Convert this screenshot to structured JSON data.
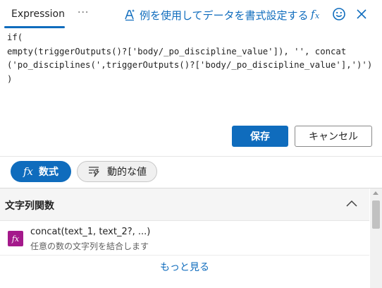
{
  "header": {
    "tab_label": "Expression",
    "more_label": "···",
    "format_label": "例を使用してデータを書式設定する"
  },
  "editor": {
    "line1": "if(",
    "line2": "empty(triggerOutputs()?['body/_po_discipline_value']), '', concat",
    "line3": "('po_disciplines(',triggerOutputs()?['body/_po_discipline_value'],')')",
    "line4": ")"
  },
  "buttons": {
    "save": "保存",
    "cancel": "キャンセル"
  },
  "toggles": {
    "formula_icon": "fx",
    "formula": "数式",
    "dynamic": "動的な値"
  },
  "panel": {
    "section_title": "文字列関数",
    "functions": [
      {
        "icon": "fx",
        "signature": "concat(text_1, text_2?, ...)",
        "description": "任意の数の文字列を結合します"
      }
    ],
    "see_more": "もっと見る"
  },
  "colors": {
    "accent": "#0f6cbd",
    "function_icon_bg": "#a4198b"
  },
  "icons": [
    "sparkle-format-icon",
    "fx-icon",
    "smiley-feedback-icon",
    "close-icon",
    "dynamic-content-icon",
    "chevron-up-icon"
  ]
}
